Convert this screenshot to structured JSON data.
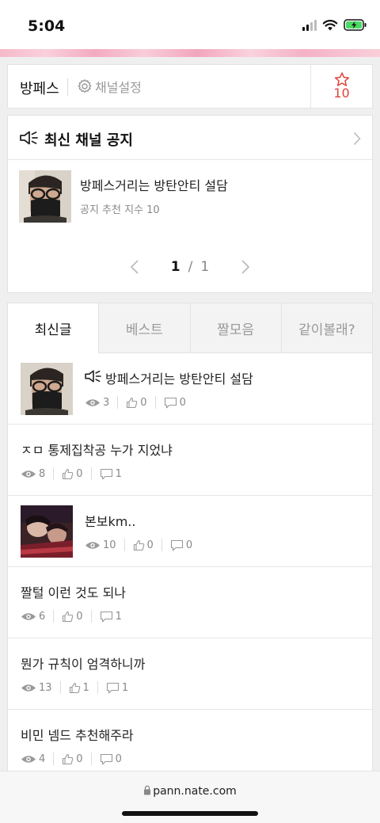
{
  "status": {
    "time": "5:04"
  },
  "channel": {
    "name": "방페스",
    "settings_label": "채널설정",
    "favorite_count": "10"
  },
  "notice": {
    "header_title": "최신 채널 공지",
    "post_title": "방페스거리는 방탄안티 설담",
    "post_meta": "공지 추천 지수 10",
    "pager_current": "1",
    "pager_sep": "/",
    "pager_total": "1"
  },
  "tabs": [
    {
      "label": "최신글",
      "active": true
    },
    {
      "label": "베스트",
      "active": false
    },
    {
      "label": "짤모음",
      "active": false
    },
    {
      "label": "같이볼래?",
      "active": false
    }
  ],
  "posts": [
    {
      "title": "방페스거리는 방탄안티 설담",
      "views": "3",
      "likes": "0",
      "comments": "0",
      "has_thumb": true,
      "has_notice_icon": true
    },
    {
      "title": "ㅈㅁ 통제집착공 누가 지었냐",
      "views": "8",
      "likes": "0",
      "comments": "1",
      "has_thumb": false
    },
    {
      "title": "본보km..",
      "views": "10",
      "likes": "0",
      "comments": "0",
      "has_thumb": true
    },
    {
      "title": "짤털 이런 것도 되나",
      "views": "6",
      "likes": "0",
      "comments": "1",
      "has_thumb": false
    },
    {
      "title": "뭔가 규칙이 엄격하니까",
      "views": "13",
      "likes": "1",
      "comments": "1",
      "has_thumb": false
    },
    {
      "title": "비민 넴드 추천해주라",
      "views": "4",
      "likes": "0",
      "comments": "0",
      "has_thumb": false
    }
  ],
  "browser": {
    "url": "pann.nate.com"
  },
  "colors": {
    "accent_red": "#e0413a",
    "pink_strip": "#f5b9c9"
  }
}
